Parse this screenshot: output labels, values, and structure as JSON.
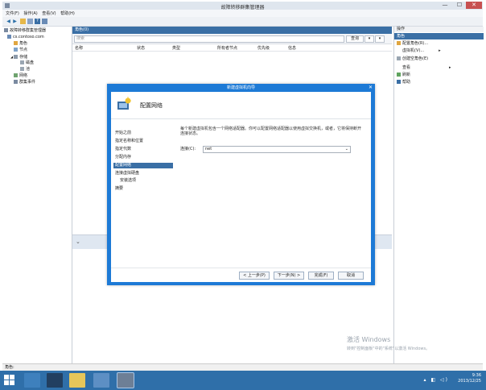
{
  "window": {
    "title": "故障转移群集管理器",
    "min": "—",
    "max": "☐",
    "close": "✕"
  },
  "menu": [
    "文件(F)",
    "操作(A)",
    "查看(V)",
    "帮助(H)"
  ],
  "tree": {
    "root": "故障转移群集管理器",
    "cluster": "cs.contoso.com",
    "roles": "角色",
    "nodes": "节点",
    "storage": "存储",
    "disks": "磁盘",
    "pools": "池",
    "networks": "网络",
    "events": "群集事件"
  },
  "center": {
    "header": "角色(0)",
    "search_placeholder": "搜索",
    "query_label": "查询",
    "columns": [
      "名称",
      "状态",
      "类型",
      "所有者节点",
      "优先级",
      "信息"
    ]
  },
  "actions": {
    "header": "操作",
    "section": "角色",
    "items": [
      "配置角色(R)...",
      "虚拟机(V)...",
      "创建空角色(E)",
      "查看",
      "刷新",
      "帮助"
    ]
  },
  "dialog": {
    "title": "新建虚拟机向导",
    "heading": "配置网络",
    "steps": [
      "开始之前",
      "指定名称和位置",
      "指定代数",
      "分配内存",
      "配置网络",
      "连接虚拟硬盘",
      "安装选项",
      "摘要"
    ],
    "description": "每个新建虚拟机包含一个网络适配器。你可以配置网络适配器以使用虚拟交换机，或者，它将保持断开连接状态。",
    "connection_label": "连接(C):",
    "connection_value": "net",
    "buttons": {
      "previous": "< 上一步(P)",
      "next": "下一步(N) >",
      "finish": "完成(F)",
      "cancel": "取消"
    }
  },
  "statusbar": "角色:",
  "watermark": {
    "line1": "激活 Windows",
    "line2": "转到\"控制面板\"中的\"系统\"以激活 Windows。"
  },
  "taskbar": {
    "time": "9:36",
    "date": "2013/12/25"
  },
  "colors": {
    "titlebar_accent": "#2b6fa8",
    "dialog_border": "#1d7ad6",
    "selection": "#3a6fa5",
    "taskbar": "#2f6fa9"
  }
}
